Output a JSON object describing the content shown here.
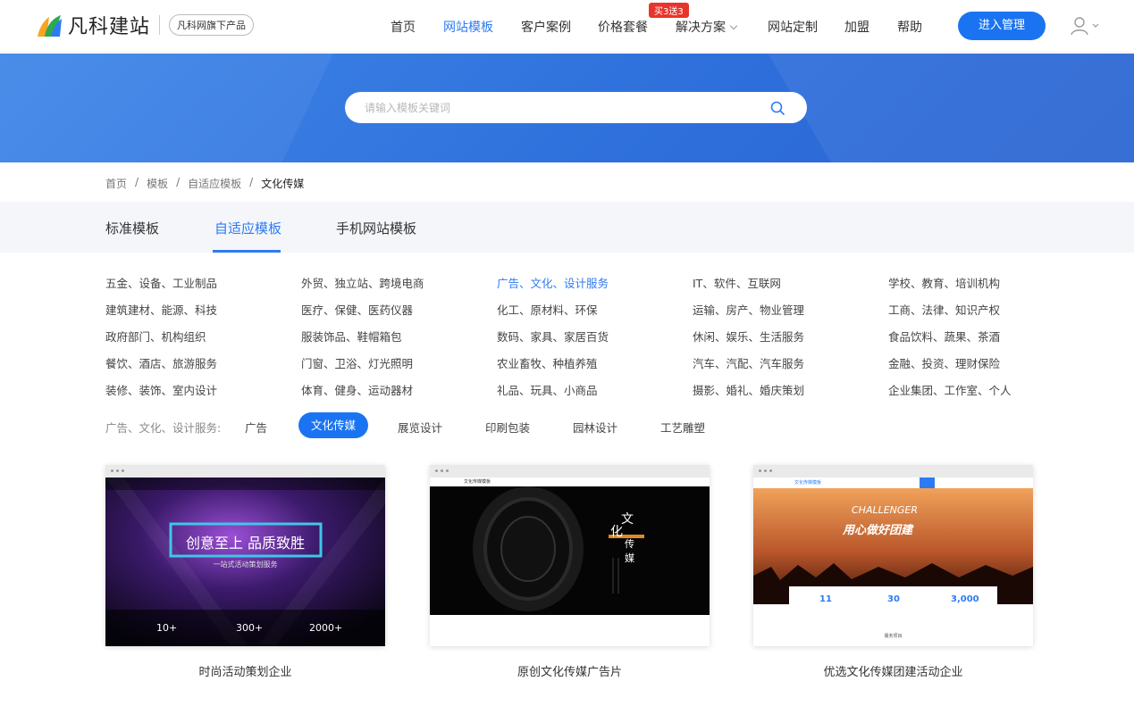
{
  "header": {
    "brand_name": "凡科建站",
    "brand_tag": "凡科网旗下产品",
    "nav": [
      {
        "label": "首页",
        "active": false
      },
      {
        "label": "网站模板",
        "active": true
      },
      {
        "label": "客户案例",
        "active": false
      },
      {
        "label": "价格套餐",
        "active": false
      },
      {
        "label": "解决方案",
        "active": false
      },
      {
        "label": "网站定制",
        "active": false
      },
      {
        "label": "加盟",
        "active": false
      },
      {
        "label": "帮助",
        "active": false
      }
    ],
    "promo_badge": "买3送3",
    "manage_button": "进入管理",
    "colors": {
      "accent": "#2d7bf2",
      "button": "#1a74f1",
      "promo": "#e8352b",
      "hero": "#3a80e5"
    }
  },
  "search": {
    "placeholder": "请输入模板关键词",
    "icon": "search-icon"
  },
  "breadcrumb": {
    "items": [
      "首页",
      "模板",
      "自适应模板"
    ],
    "current": "文化传媒"
  },
  "tabs": [
    "标准模板",
    "自适应模板",
    "手机网站模板"
  ],
  "active_tab": "自适应模板",
  "categories": [
    [
      "五金、设备、工业制品",
      "建筑建材、能源、科技",
      "政府部门、机构组织",
      "餐饮、酒店、旅游服务",
      "装修、装饰、室内设计"
    ],
    [
      "外贸、独立站、跨境电商",
      "医疗、保健、医药仪器",
      "服装饰品、鞋帽箱包",
      "门窗、卫浴、灯光照明",
      "体育、健身、运动器材"
    ],
    [
      "广告、文化、设计服务",
      "化工、原材料、环保",
      "数码、家具、家居百货",
      "农业畜牧、种植养殖",
      "礼品、玩具、小商品"
    ],
    [
      "IT、软件、互联网",
      "运输、房产、物业管理",
      "休闲、娱乐、生活服务",
      "汽车、汽配、汽车服务",
      "摄影、婚礼、婚庆策划"
    ],
    [
      "学校、教育、培训机构",
      "工商、法律、知识产权",
      "食品饮料、蔬果、茶酒",
      "金融、投资、理财保险",
      "企业集团、工作室、个人"
    ]
  ],
  "active_category": "广告、文化、设计服务",
  "subcategory": {
    "label": "广告、文化、设计服务:",
    "items": [
      "广告",
      "文化传媒",
      "展览设计",
      "印刷包装",
      "园林设计",
      "工艺雕塑"
    ],
    "active": "文化传媒"
  },
  "templates": [
    {
      "title": "时尚活动策划企业",
      "thumb": {
        "headline": "创意至上 品质致胜",
        "subline": "一站式活动策划服务",
        "stats": [
          "10+",
          "300+",
          "2000+"
        ]
      }
    },
    {
      "title": "原创文化传媒广告片",
      "thumb": {
        "site_name": "文化传媒模板",
        "vertical_text_a": "文",
        "vertical_text_b": "化",
        "vertical_text_c": "传",
        "vertical_text_d": "媒"
      }
    },
    {
      "title": "优选文化传媒团建活动企业",
      "thumb": {
        "site_name": "文化传媒模板",
        "banner_en": "CHALLENGER",
        "banner_cn": "用心做好团建",
        "stats": [
          "11",
          "30",
          "3,000"
        ],
        "footer": "服务项目"
      }
    }
  ]
}
